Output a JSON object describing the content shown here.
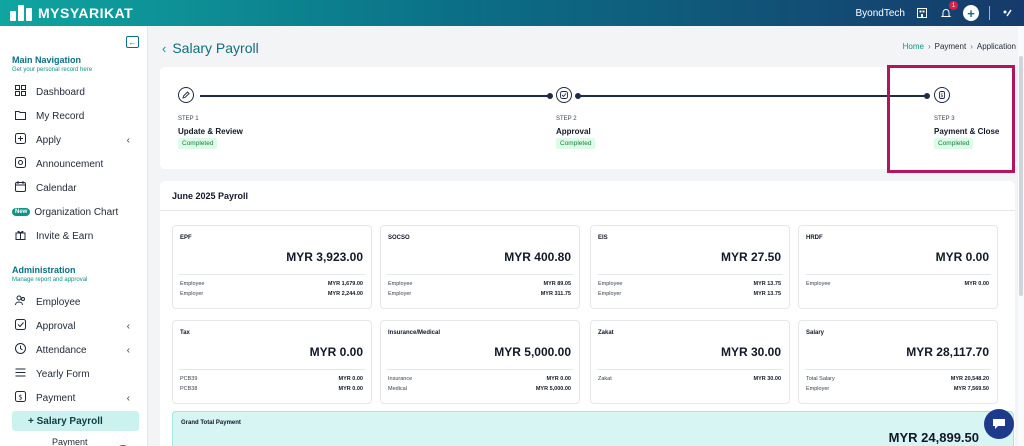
{
  "topbar": {
    "logo_text": "MYSYARIKAT",
    "company": "ByondTech",
    "notification_count": "1"
  },
  "sidebar": {
    "main_nav_title": "Main Navigation",
    "main_nav_sub": "Get your personal record here",
    "main_items": [
      {
        "label": "Dashboard",
        "icon": "dashboard-icon"
      },
      {
        "label": "My Record",
        "icon": "folder-icon"
      },
      {
        "label": "Apply",
        "icon": "apply-icon"
      },
      {
        "label": "Announcement",
        "icon": "announcement-icon"
      },
      {
        "label": "Calendar",
        "icon": "calendar-icon"
      },
      {
        "label": "Organization Chart",
        "icon": "new-badge",
        "badge": "New"
      },
      {
        "label": "Invite & Earn",
        "icon": "gift-icon"
      }
    ],
    "admin_title": "Administration",
    "admin_sub": "Manage report and approval",
    "admin_items": [
      {
        "label": "Employee",
        "icon": "people-icon"
      },
      {
        "label": "Approval",
        "icon": "check-square-icon"
      },
      {
        "label": "Attendance",
        "icon": "clock-icon"
      },
      {
        "label": "Yearly Form",
        "icon": "form-icon"
      },
      {
        "label": "Payment",
        "icon": "dollar-icon"
      }
    ],
    "active_sub": "+ Salary Payroll",
    "next_sub": "Payment"
  },
  "header": {
    "title": "Salary Payroll",
    "breadcrumb": [
      "Home",
      "Payment",
      "Application"
    ]
  },
  "stepper": {
    "steps": [
      {
        "label": "STEP 1",
        "name": "Update & Review",
        "status": "Completed",
        "icon": "edit-icon"
      },
      {
        "label": "STEP 2",
        "name": "Approval",
        "status": "Completed",
        "icon": "check-circle-icon"
      },
      {
        "label": "STEP 3",
        "name": "Payment & Close",
        "status": "Completed",
        "icon": "money-icon"
      }
    ]
  },
  "payroll": {
    "title": "June 2025 Payroll",
    "cards": [
      {
        "title": "EPF",
        "amount": "MYR 3,923.00",
        "rows": [
          [
            "Employee",
            "MYR 1,679.00"
          ],
          [
            "Employer",
            "MYR 2,244.00"
          ]
        ]
      },
      {
        "title": "SOCSO",
        "amount": "MYR 400.80",
        "rows": [
          [
            "Employee",
            "MYR 89.05"
          ],
          [
            "Employer",
            "MYR 311.75"
          ]
        ]
      },
      {
        "title": "EIS",
        "amount": "MYR 27.50",
        "rows": [
          [
            "Employee",
            "MYR 13.75"
          ],
          [
            "Employer",
            "MYR 13.75"
          ]
        ]
      },
      {
        "title": "HRDF",
        "amount": "MYR 0.00",
        "rows": [
          [
            "Employee",
            "MYR 0.00"
          ]
        ]
      },
      {
        "title": "Tax",
        "amount": "MYR 0.00",
        "rows": [
          [
            "PCB39",
            "MYR 0.00"
          ],
          [
            "PCB38",
            "MYR 0.00"
          ]
        ]
      },
      {
        "title": "Insurance/Medical",
        "amount": "MYR 5,000.00",
        "rows": [
          [
            "Insurance",
            "MYR 0.00"
          ],
          [
            "Medical",
            "MYR 5,000.00"
          ]
        ]
      },
      {
        "title": "Zakat",
        "amount": "MYR 30.00",
        "rows": [
          [
            "Zakat",
            "MYR 30.00"
          ]
        ]
      },
      {
        "title": "Salary",
        "amount": "MYR 28,117.70",
        "rows": [
          [
            "Total Salary",
            "MYR 20,548.20"
          ],
          [
            "Employer",
            "MYR 7,569.50"
          ]
        ]
      }
    ],
    "grand_title": "Grand Total Payment",
    "grand_amount": "MYR 24,899.50"
  }
}
